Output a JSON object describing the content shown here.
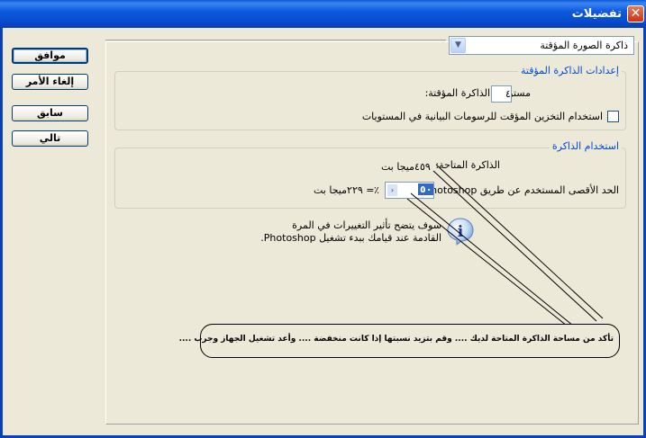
{
  "window": {
    "title": "تفضيلات",
    "close_glyph": "✕"
  },
  "buttons": {
    "ok": "موافق",
    "cancel": "إلغاء الأمر",
    "prev": "سابق",
    "next": "تالي"
  },
  "section_select": {
    "value": "ذاكرة الصورة المؤقتة",
    "icon": "chevron-down-icon"
  },
  "cache_settings": {
    "legend": "إعدادات الذاكرة المؤقتة",
    "levels_label": "مستويات الذاكرة المؤقتة:",
    "levels_value": "٤",
    "histogram_label": "استخدام التخزين المؤقت للرسومات البيانية في المستويات",
    "histogram_checked": false
  },
  "memory_usage": {
    "legend": "استخدام الذاكرة",
    "available_label": "الذاكرة المتاحة:",
    "available_value": "٤٥٩ميجا بت",
    "max_label": "الحد الأقصى المستخدم عن طريق Photoshop:",
    "max_value": "٥٠",
    "percent_sign": "٪",
    "max_result": "= ٢٢٩ميجا بت"
  },
  "notice": {
    "line1": "سوف يتضح تأثير التغييرات في المرة",
    "line2": "القادمة عند قيامك ببدء تشغيل Photoshop."
  },
  "annotation": {
    "text": "تأكد من مساحة الذاكرة المتاحة لديك .... وقم بتزيد نسبتها إذا كانت منخفضة .... وأعد تشغيل الجهاز وجرب ...."
  }
}
